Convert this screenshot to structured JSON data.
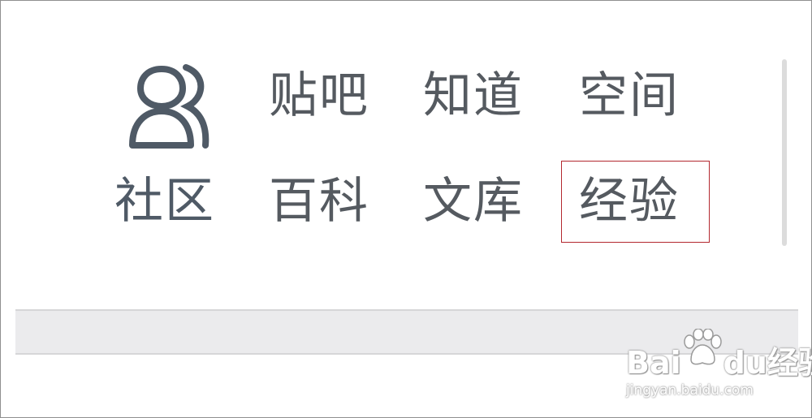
{
  "community": {
    "label": "社区",
    "icon": "users-icon",
    "icon_color": "#4f5a66"
  },
  "nav": {
    "tieba": "贴吧",
    "zhidao": "知道",
    "kongjian": "空间",
    "baike": "百科",
    "wenku": "文库",
    "jingyan": "经验"
  },
  "highlight": {
    "target": "jingyan",
    "color": "#b3282f"
  },
  "watermark": {
    "logo_prefix": "Bai",
    "logo_mid": "du",
    "logo_suffix": "经验",
    "url": "jingyan.baidu.com",
    "icon": "paw-icon"
  }
}
